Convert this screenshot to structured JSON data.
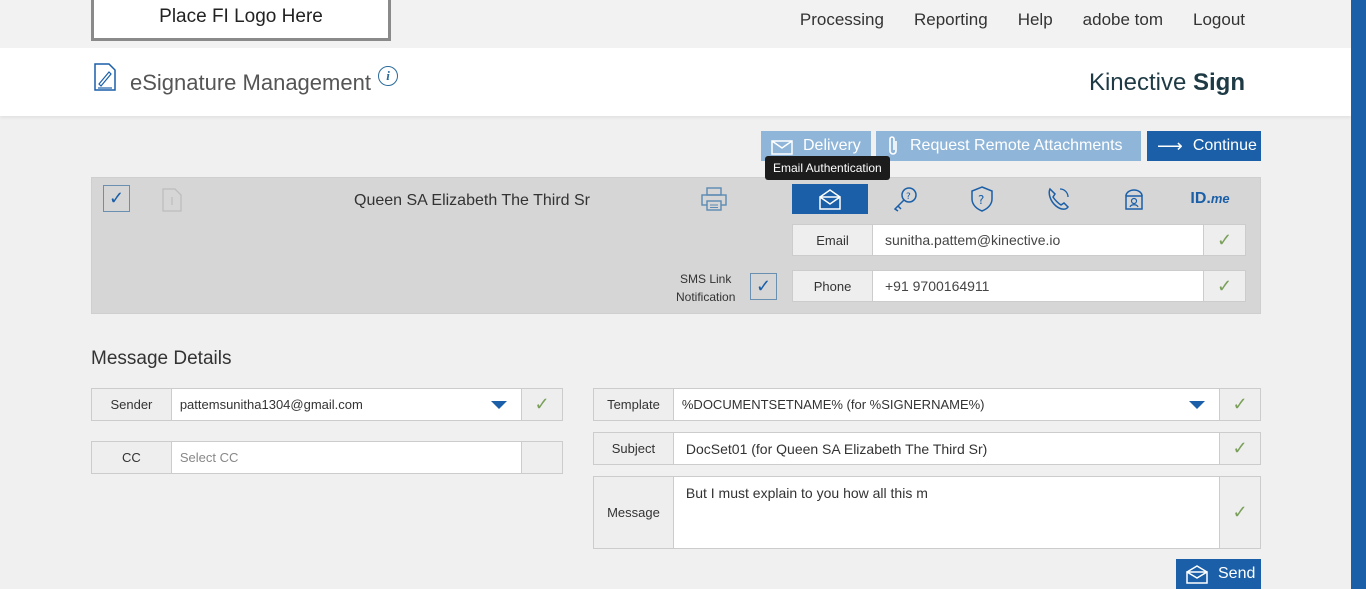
{
  "logo": {
    "text": "Place FI Logo Here"
  },
  "nav": {
    "processing": "Processing",
    "reporting": "Reporting",
    "help": "Help",
    "user": "adobe tom",
    "logout": "Logout"
  },
  "header": {
    "title": "eSignature Management",
    "info_glyph": "i",
    "brand_light": "Kinective",
    "brand_bold": "Sign"
  },
  "actions": {
    "delivery": "Delivery",
    "remote_attachments": "Request Remote Attachments",
    "continue": "Continue"
  },
  "tooltip": {
    "text": "Email Authentication"
  },
  "signer": {
    "name": "Queen SA Elizabeth The Third Sr",
    "checked": true,
    "auth_methods": [
      "email-auth-icon",
      "kba-icon",
      "shield-question-icon",
      "phone-auth-icon",
      "id-check-icon",
      "idme-logo"
    ],
    "active_auth": "Email Authentication",
    "idme_id": "ID.",
    "idme_me": "me",
    "sms_label_line1": "SMS Link",
    "sms_label_line2": "Notification",
    "email_label": "Email",
    "email_value": "sunitha.pattem@kinective.io",
    "phone_label": "Phone",
    "phone_value": "+91 9700164911"
  },
  "message_details": {
    "title": "Message Details",
    "sender_label": "Sender",
    "sender_value": "pattemsunitha1304@gmail.com",
    "cc_label": "CC",
    "cc_placeholder": "Select CC",
    "template_label": "Template",
    "template_value": "%DOCUMENTSETNAME% (for %SIGNERNAME%)",
    "subject_label": "Subject",
    "subject_value": "DocSet01 (for Queen SA Elizabeth The Third Sr)",
    "message_label": "Message",
    "message_value": "But I must explain to you how all this m",
    "send": "Send"
  },
  "glyphs": {
    "check": "✓",
    "arrow": "⟶"
  },
  "colors": {
    "primary": "#1a5fa8",
    "primary_light": "#8fb6d9",
    "check_green": "#7aa05a"
  }
}
